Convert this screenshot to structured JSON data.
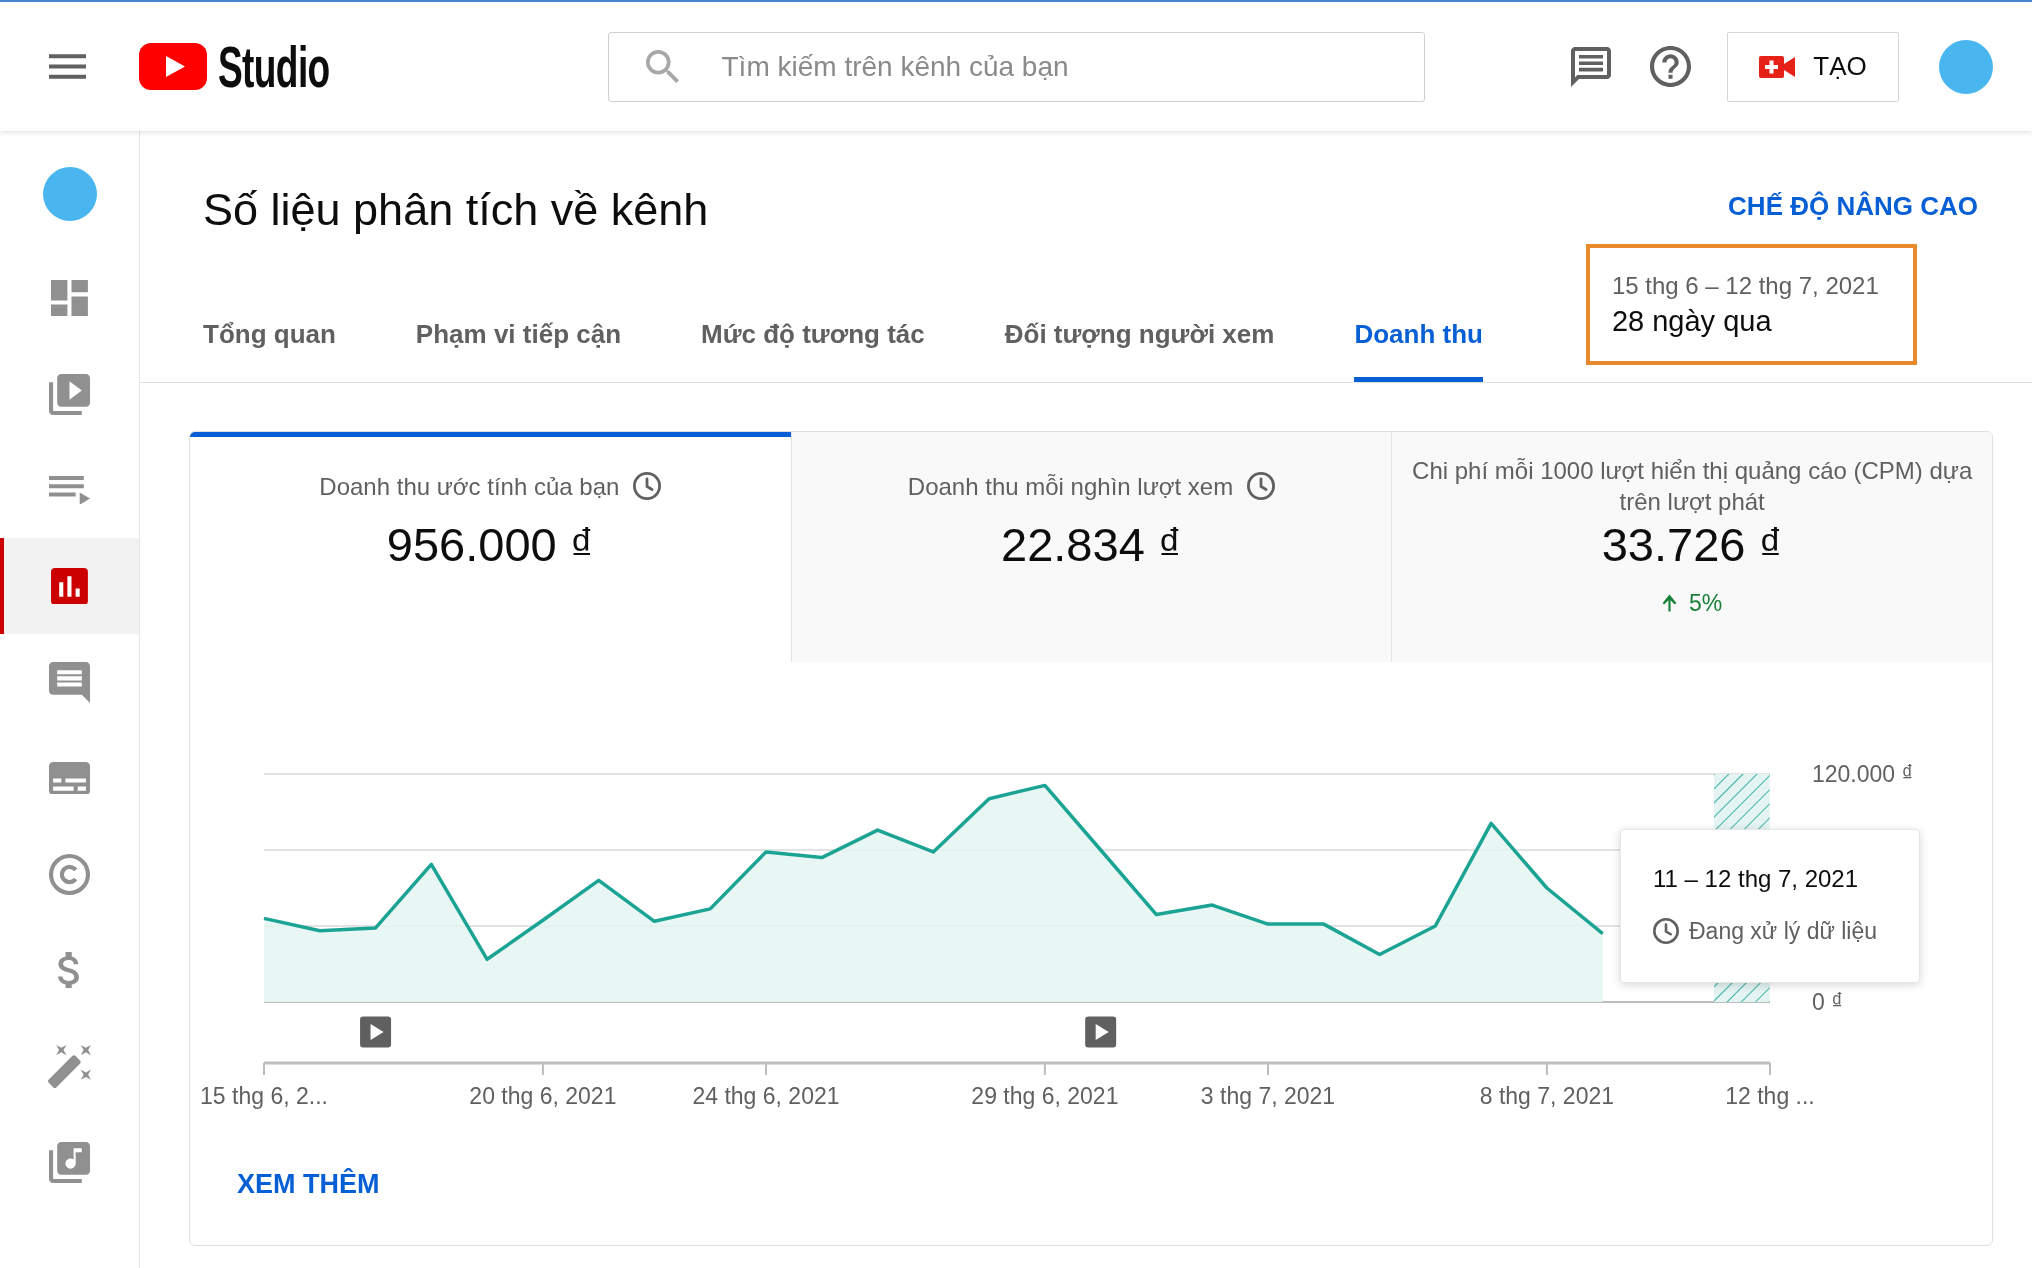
{
  "header": {
    "logo_text": "Studio",
    "search": {
      "placeholder": "Tìm kiếm trên kênh của bạn"
    },
    "create_button": {
      "label": "TẠO"
    }
  },
  "sidebar": {
    "items": [
      {
        "kind": "dashboard",
        "selected": false
      },
      {
        "kind": "content",
        "selected": false
      },
      {
        "kind": "playlists",
        "selected": false
      },
      {
        "kind": "analytics",
        "selected": true
      },
      {
        "kind": "comments",
        "selected": false
      },
      {
        "kind": "subtitles",
        "selected": false
      },
      {
        "kind": "copyright",
        "selected": false
      },
      {
        "kind": "monetization",
        "selected": false
      },
      {
        "kind": "customization",
        "selected": false
      },
      {
        "kind": "audio_library",
        "selected": false
      }
    ]
  },
  "page": {
    "title": "Số liệu phân tích về kênh",
    "advanced_mode_link": "CHẾ ĐỘ NÂNG CAO"
  },
  "tabs": [
    {
      "label": "Tổng quan",
      "selected": false
    },
    {
      "label": "Phạm vi tiếp cận",
      "selected": false
    },
    {
      "label": "Mức độ tương tác",
      "selected": false
    },
    {
      "label": "Đối tượng người xem",
      "selected": false
    },
    {
      "label": "Doanh thu",
      "selected": true
    }
  ],
  "date_range": {
    "range": "15 thg 6 – 12 thg 7, 2021",
    "period": "28 ngày qua",
    "highlighted": true
  },
  "metrics": [
    {
      "label": "Doanh thu ước tính của bạn",
      "value": "956.000 ₫",
      "delayed_data": true,
      "selected": true
    },
    {
      "label": "Doanh thu mỗi nghìn lượt xem",
      "value": "22.834 ₫",
      "delayed_data": true,
      "selected": false
    },
    {
      "label": "Chi phí mỗi 1000 lượt hiển thị quảng cáo (CPM) dựa trên lượt phát",
      "value": "33.726 ₫",
      "delayed_data": false,
      "selected": false,
      "change": "5%",
      "increase": true
    }
  ],
  "chart": {
    "chart_data": {
      "type": "area",
      "categories": [
        "15 thg 6, 2...",
        null,
        null,
        null,
        null,
        "20 thg 6, 2021",
        null,
        null,
        null,
        "24 thg 6, 2021",
        null,
        null,
        null,
        null,
        "29 thg 6, 2021",
        null,
        null,
        null,
        "3 thg 7, 2021",
        null,
        null,
        null,
        null,
        "8 thg 7, 2021",
        null,
        null,
        null,
        "12 thg ..."
      ],
      "values": [
        44000,
        37500,
        39000,
        72500,
        22500,
        43000,
        64000,
        42500,
        49000,
        79000,
        76000,
        90500,
        79000,
        107000,
        114000,
        80000,
        46000,
        51000,
        41000,
        41000,
        25000,
        40000,
        94000,
        60000,
        36000,
        null,
        null,
        null
      ],
      "ylim": [
        0,
        120000
      ],
      "yticks": [
        {
          "value": 0,
          "label": "0 ₫"
        },
        {
          "value": 120000,
          "label": "120.000 ₫"
        }
      ]
    },
    "tooltip": {
      "title": "11 – 12 thg 7, 2021",
      "status": "Đang xử lý dữ liệu"
    }
  },
  "more_link": "XEM THÊM"
}
